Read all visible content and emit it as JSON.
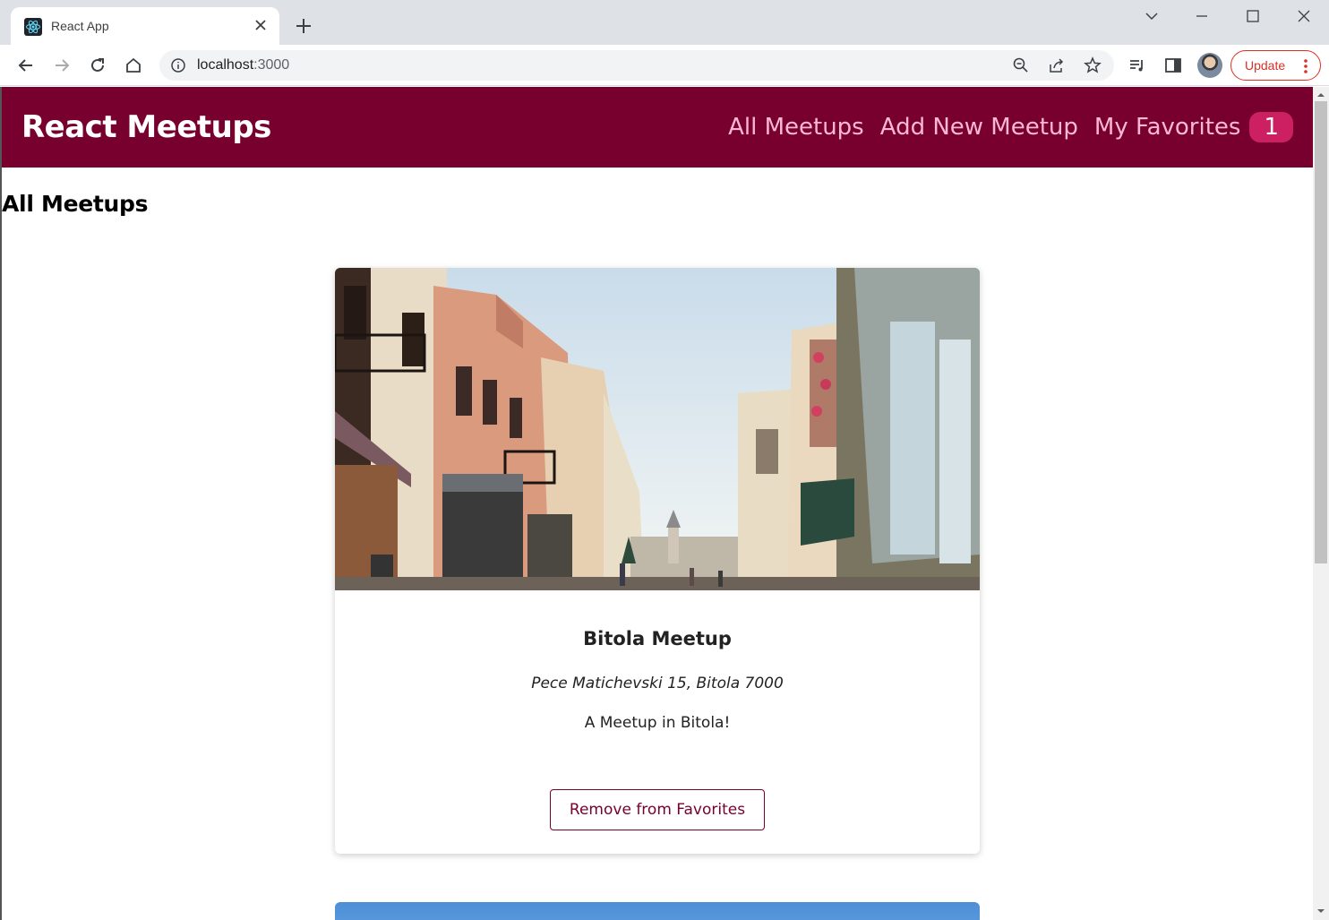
{
  "browser": {
    "tab_title": "React App",
    "url_host": "localhost",
    "url_port": ":3000",
    "update_label": "Update",
    "accent": "#d93025"
  },
  "app": {
    "logo": "React Meetups",
    "nav": {
      "all_meetups": "All Meetups",
      "add_new": "Add New Meetup",
      "favorites": "My Favorites",
      "favorites_count": "1"
    },
    "header_color": "#77002e",
    "badge_color": "#cc2062"
  },
  "page": {
    "title": "All Meetups"
  },
  "meetups": [
    {
      "title": "Bitola Meetup",
      "address": "Pece Matichevski 15, Bitola 7000",
      "description": "A Meetup in Bitola!",
      "button_label": "Remove from Favorites"
    }
  ]
}
